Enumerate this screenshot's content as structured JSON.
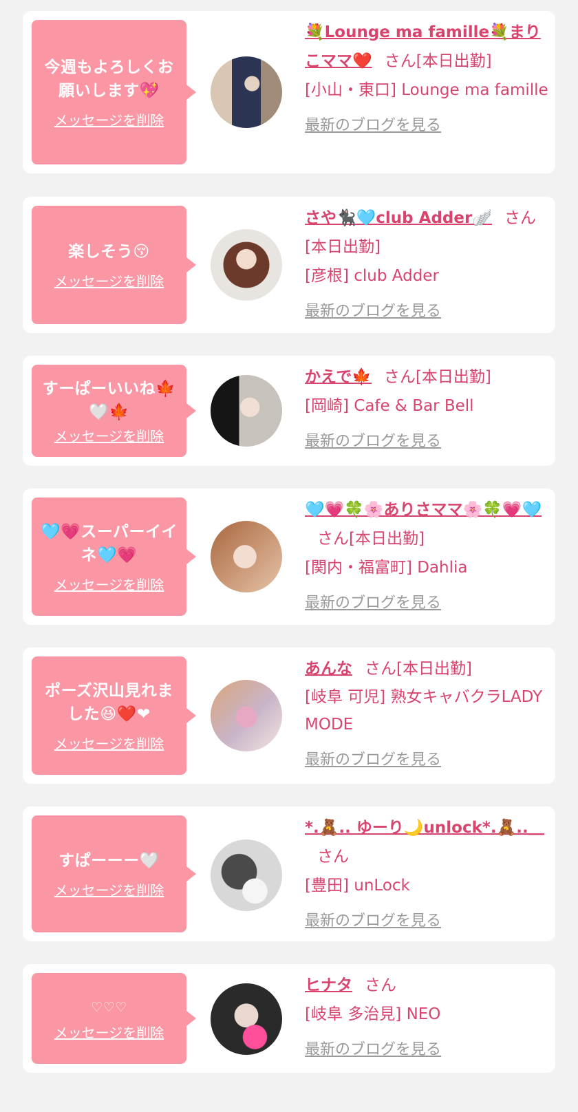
{
  "colors": {
    "accent": "#d8446d",
    "bubble": "#fb96a5",
    "link_gray": "#9a9a9a",
    "background": "#f2f2f2"
  },
  "delete_label": "メッセージを削除",
  "blog_label": "最新のブログを見る",
  "items": [
    {
      "message": "今週もよろしくお願いします💖",
      "name": "💐Lounge ma famille💐まりこママ❤️",
      "suffix": "さん[本日出勤]",
      "shop": "[小山・東口] Lounge ma famille"
    },
    {
      "message": "楽しそう😚",
      "name": "さや🐈‍⬛🩵club Adder🪽",
      "suffix": "さん[本日出勤]",
      "shop": "[彦根] club Adder"
    },
    {
      "message": "すーぱーいいね🍁🤍🍁",
      "name": "かえで🍁",
      "suffix": "さん[本日出勤]",
      "shop": "[岡崎] Cafe & Bar Bell"
    },
    {
      "message": "🩵💗スーパーイイネ🩵💗",
      "name": "🩵💗🍀🌸ありさママ🌸🍀💗🩵",
      "suffix": "さん[本日出勤]",
      "shop": "[関内・福富町] Dahlia"
    },
    {
      "message": "ポーズ沢山見れました😆❤️❤",
      "name": "あんな",
      "suffix": "さん[本日出勤]",
      "shop": "[岐阜 可児] 熟女キャバクラLADY MODE"
    },
    {
      "message": "すぱーーー🤍",
      "name": "*.🧸.. ゆーり🌙unlock*.🧸..＿",
      "suffix": "さん",
      "shop": "[豊田] unLock"
    },
    {
      "message": "♡♡♡",
      "name": "ヒナタ",
      "suffix": "さん",
      "shop": "[岐阜 多治見] NEO"
    }
  ]
}
